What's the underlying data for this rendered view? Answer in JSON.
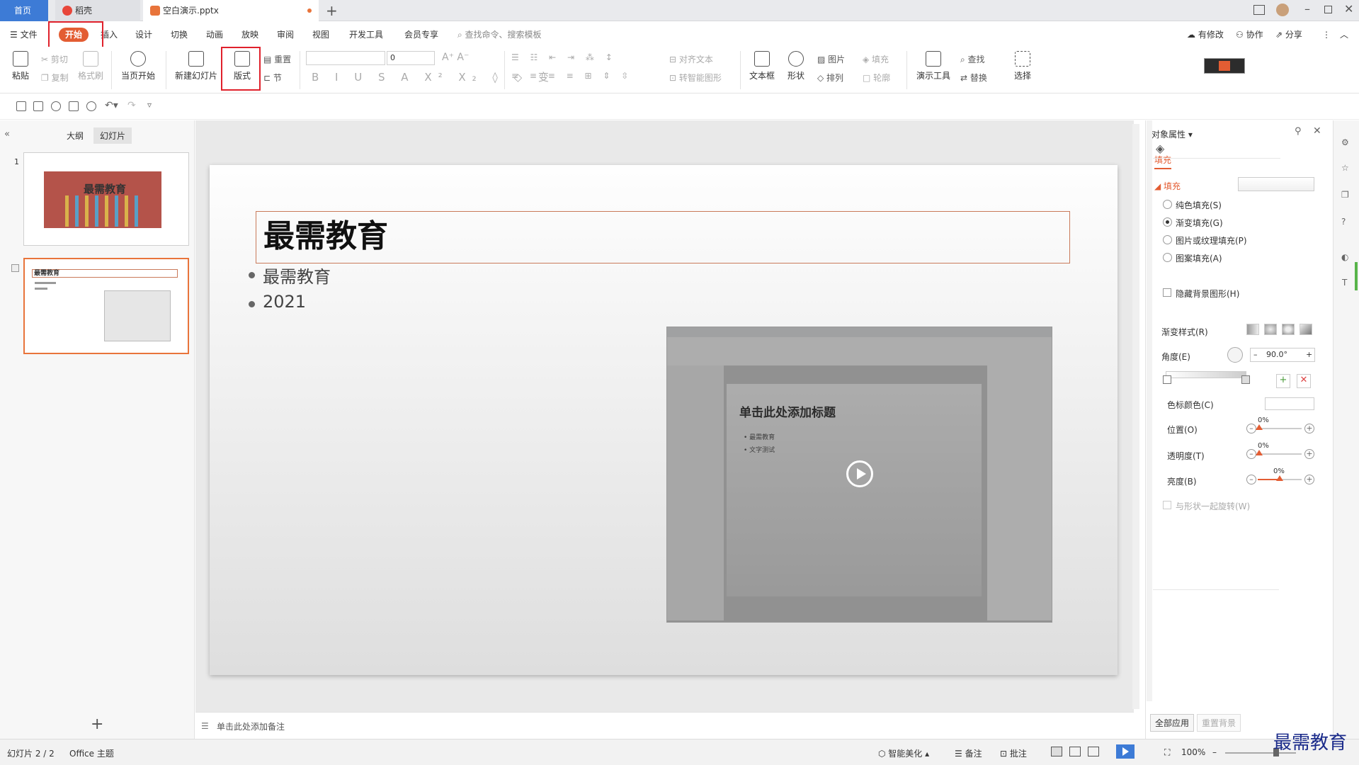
{
  "tabs": {
    "home": "首页",
    "daoke": "稻壳",
    "doc": "空白演示.pptx"
  },
  "menu": {
    "file": "文件",
    "start": "开始",
    "insert": "插入",
    "design": "设计",
    "transition": "切换",
    "animation": "动画",
    "slideshow": "放映",
    "review": "审阅",
    "view": "视图",
    "devtools": "开发工具",
    "member": "会员专享",
    "search": "查找命令、搜索模板",
    "modified": "有修改",
    "collab": "协作",
    "share": "分享"
  },
  "ribbon": {
    "paste": "粘贴",
    "cut": "剪切",
    "copy": "复制",
    "format_painter": "格式刷",
    "from_current": "当页开始",
    "new_slide": "新建幻灯片",
    "layout": "版式",
    "reset": "重置",
    "section": "节",
    "font_size": "0",
    "align_text": "对齐文本",
    "smart_art": "转智能图形",
    "textbox": "文本框",
    "shape": "形状",
    "picture": "图片",
    "fill": "填充",
    "arrange": "排列",
    "outline": "轮廓",
    "present_tools": "演示工具",
    "find": "查找",
    "replace": "替换",
    "select": "选择"
  },
  "leftpane": {
    "outline_tab": "大纲",
    "slides_tab": "幻灯片",
    "slide1_num": "1",
    "slide1_title": "最需教育",
    "slide2_title": "最需教育"
  },
  "slide": {
    "title": "最需教育",
    "bullets": [
      "最需教育",
      "2021"
    ],
    "video_title": "单击此处添加标题",
    "video_bullets": [
      "最需教育",
      "文字测试"
    ]
  },
  "notes": {
    "placeholder": "单击此处添加备注"
  },
  "rpane": {
    "header": "对象属性",
    "fill_tab": "填充",
    "fill_section": "填充",
    "options": [
      "纯色填充(S)",
      "渐变填充(G)",
      "图片或纹理填充(P)",
      "图案填充(A)"
    ],
    "hide_bg": "隐藏背景图形(H)",
    "gradient_style": "渐变样式(R)",
    "angle_label": "角度(E)",
    "angle_value": "90.0°",
    "stop_color": "色标颜色(C)",
    "position": "位置(O)",
    "transparency": "透明度(T)",
    "brightness": "亮度(B)",
    "position_val": "0%",
    "transparency_val": "0%",
    "brightness_val": "0%",
    "rotate_with_shape": "与形状一起旋转(W)",
    "apply_all": "全部应用",
    "reset_bg": "重置背景"
  },
  "status": {
    "slide_count": "幻灯片 2 / 2",
    "theme": "Office 主题",
    "beautify": "智能美化",
    "notes": "备注",
    "comments": "批注",
    "zoom": "100%"
  },
  "watermark": "最需教育",
  "colors": {
    "accent": "#e35d33",
    "home_tab": "#3d7bd6",
    "highlight_box": "#e0212c"
  }
}
